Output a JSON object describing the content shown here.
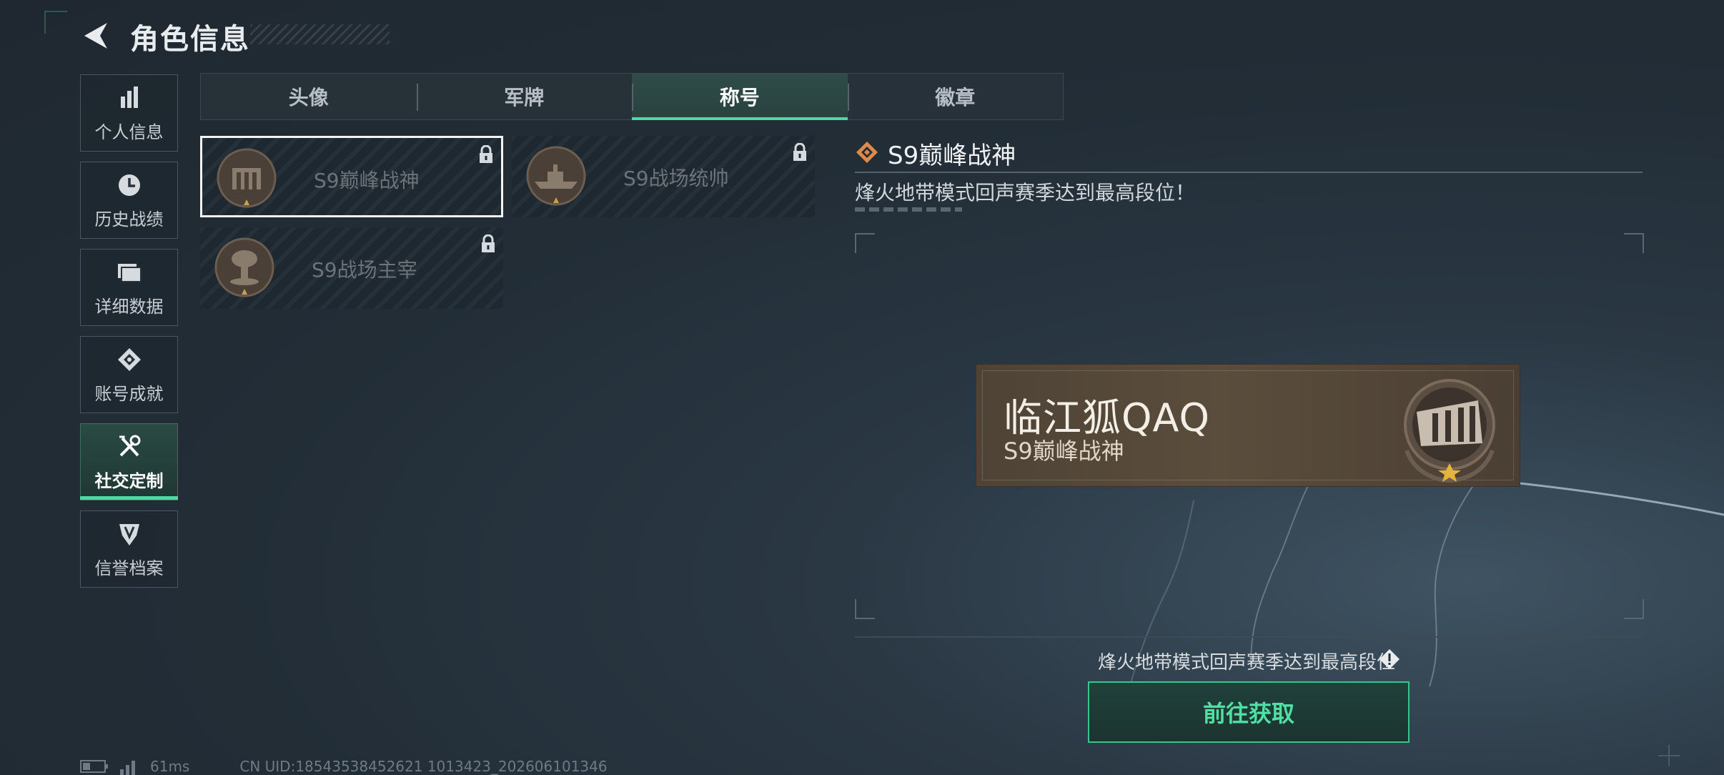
{
  "header": {
    "title": "角色信息"
  },
  "sidebar": {
    "items": [
      {
        "label": "个人信息",
        "icon": "bar-chart-icon"
      },
      {
        "label": "历史战绩",
        "icon": "history-clock-icon"
      },
      {
        "label": "详细数据",
        "icon": "folder-icon"
      },
      {
        "label": "账号成就",
        "icon": "achievement-icon"
      },
      {
        "label": "社交定制",
        "icon": "tools-icon",
        "active": true
      },
      {
        "label": "信誉档案",
        "icon": "credit-badge-icon"
      }
    ]
  },
  "tabs": [
    {
      "label": "头像"
    },
    {
      "label": "军牌"
    },
    {
      "label": "称号",
      "active": true
    },
    {
      "label": "徽章"
    }
  ],
  "titles": [
    {
      "name": "S9巅峰战神",
      "locked": true,
      "selected": true,
      "medal": "fortress-medal-icon"
    },
    {
      "name": "S9战场统帅",
      "locked": true,
      "selected": false,
      "medal": "warship-medal-icon"
    },
    {
      "name": "S9战场主宰",
      "locked": true,
      "selected": false,
      "medal": "mushroom-cloud-medal-icon"
    }
  ],
  "detail": {
    "title": "S9巅峰战神",
    "description": "烽火地带模式回声赛季达到最高段位！",
    "nameplate": {
      "player_name": "临江狐QAQ",
      "title": "S9巅峰战神"
    },
    "requirement": "烽火地带模式回声赛季达到最高段位",
    "action_label": "前往获取"
  },
  "status": {
    "ping": "61ms",
    "uid": "CN UID:18543538452621 1013423_202606101346"
  },
  "colors": {
    "accent": "#4fd8a0",
    "title_icon": "#e08a4a",
    "background": "#222d36"
  }
}
